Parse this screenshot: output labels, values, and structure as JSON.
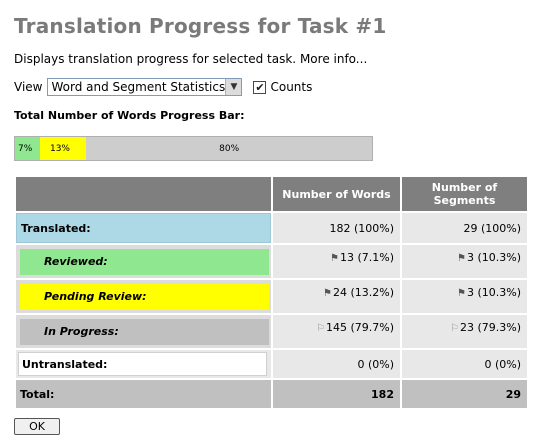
{
  "header": {
    "title": "Translation Progress for Task #1",
    "description": "Displays translation progress for selected task.",
    "more_info_link": "More info..."
  },
  "view": {
    "label": "View",
    "selected_option": "Word and Segment Statistics",
    "counts_label": "Counts",
    "counts_checked": true
  },
  "progress_bar": {
    "title": "Total Number of Words Progress Bar:",
    "segments": [
      {
        "name": "Reviewed",
        "label": "7%",
        "percent": 7,
        "color": "#8fe88f"
      },
      {
        "name": "Pending Review",
        "label": "13%",
        "percent": 13,
        "color": "#ffff00"
      },
      {
        "name": "In Progress",
        "label": "80%",
        "percent": 80,
        "color": "#cdcdcd"
      }
    ]
  },
  "table": {
    "col_words": "Number of Words",
    "col_segments_line1": "Number of",
    "col_segments_line2": "Segments",
    "rows": {
      "translated": {
        "label": "Translated:",
        "words": "182 (100%)",
        "segments": "29 (100%)"
      },
      "reviewed": {
        "label": "Reviewed:",
        "words": "13 (7.1%)",
        "segments": "3 (10.3%)"
      },
      "pending": {
        "label": "Pending Review:",
        "words": "24 (13.2%)",
        "segments": "3 (10.3%)"
      },
      "in_progress": {
        "label": "In Progress:",
        "words": "145 (79.7%)",
        "segments": "23 (79.3%)"
      },
      "untranslated": {
        "label": "Untranslated:",
        "words": "0 (0%)",
        "segments": "0 (0%)"
      },
      "total": {
        "label": "Total:",
        "words": "182",
        "segments": "29"
      }
    }
  },
  "buttons": {
    "ok": "OK"
  },
  "colors": {
    "title_gray": "#7a7a7a",
    "header_gray": "#7f7f7f",
    "translated_blue": "#add8e6",
    "reviewed_green": "#8fe88f",
    "pending_yellow": "#ffff00",
    "inprogress_gray": "#c0c0c0"
  },
  "icons": {
    "status_flag": "flag-icon",
    "status_flag_outline": "flag-outline-icon",
    "dropdown": "chevron-down-icon",
    "checkbox": "check-icon"
  }
}
